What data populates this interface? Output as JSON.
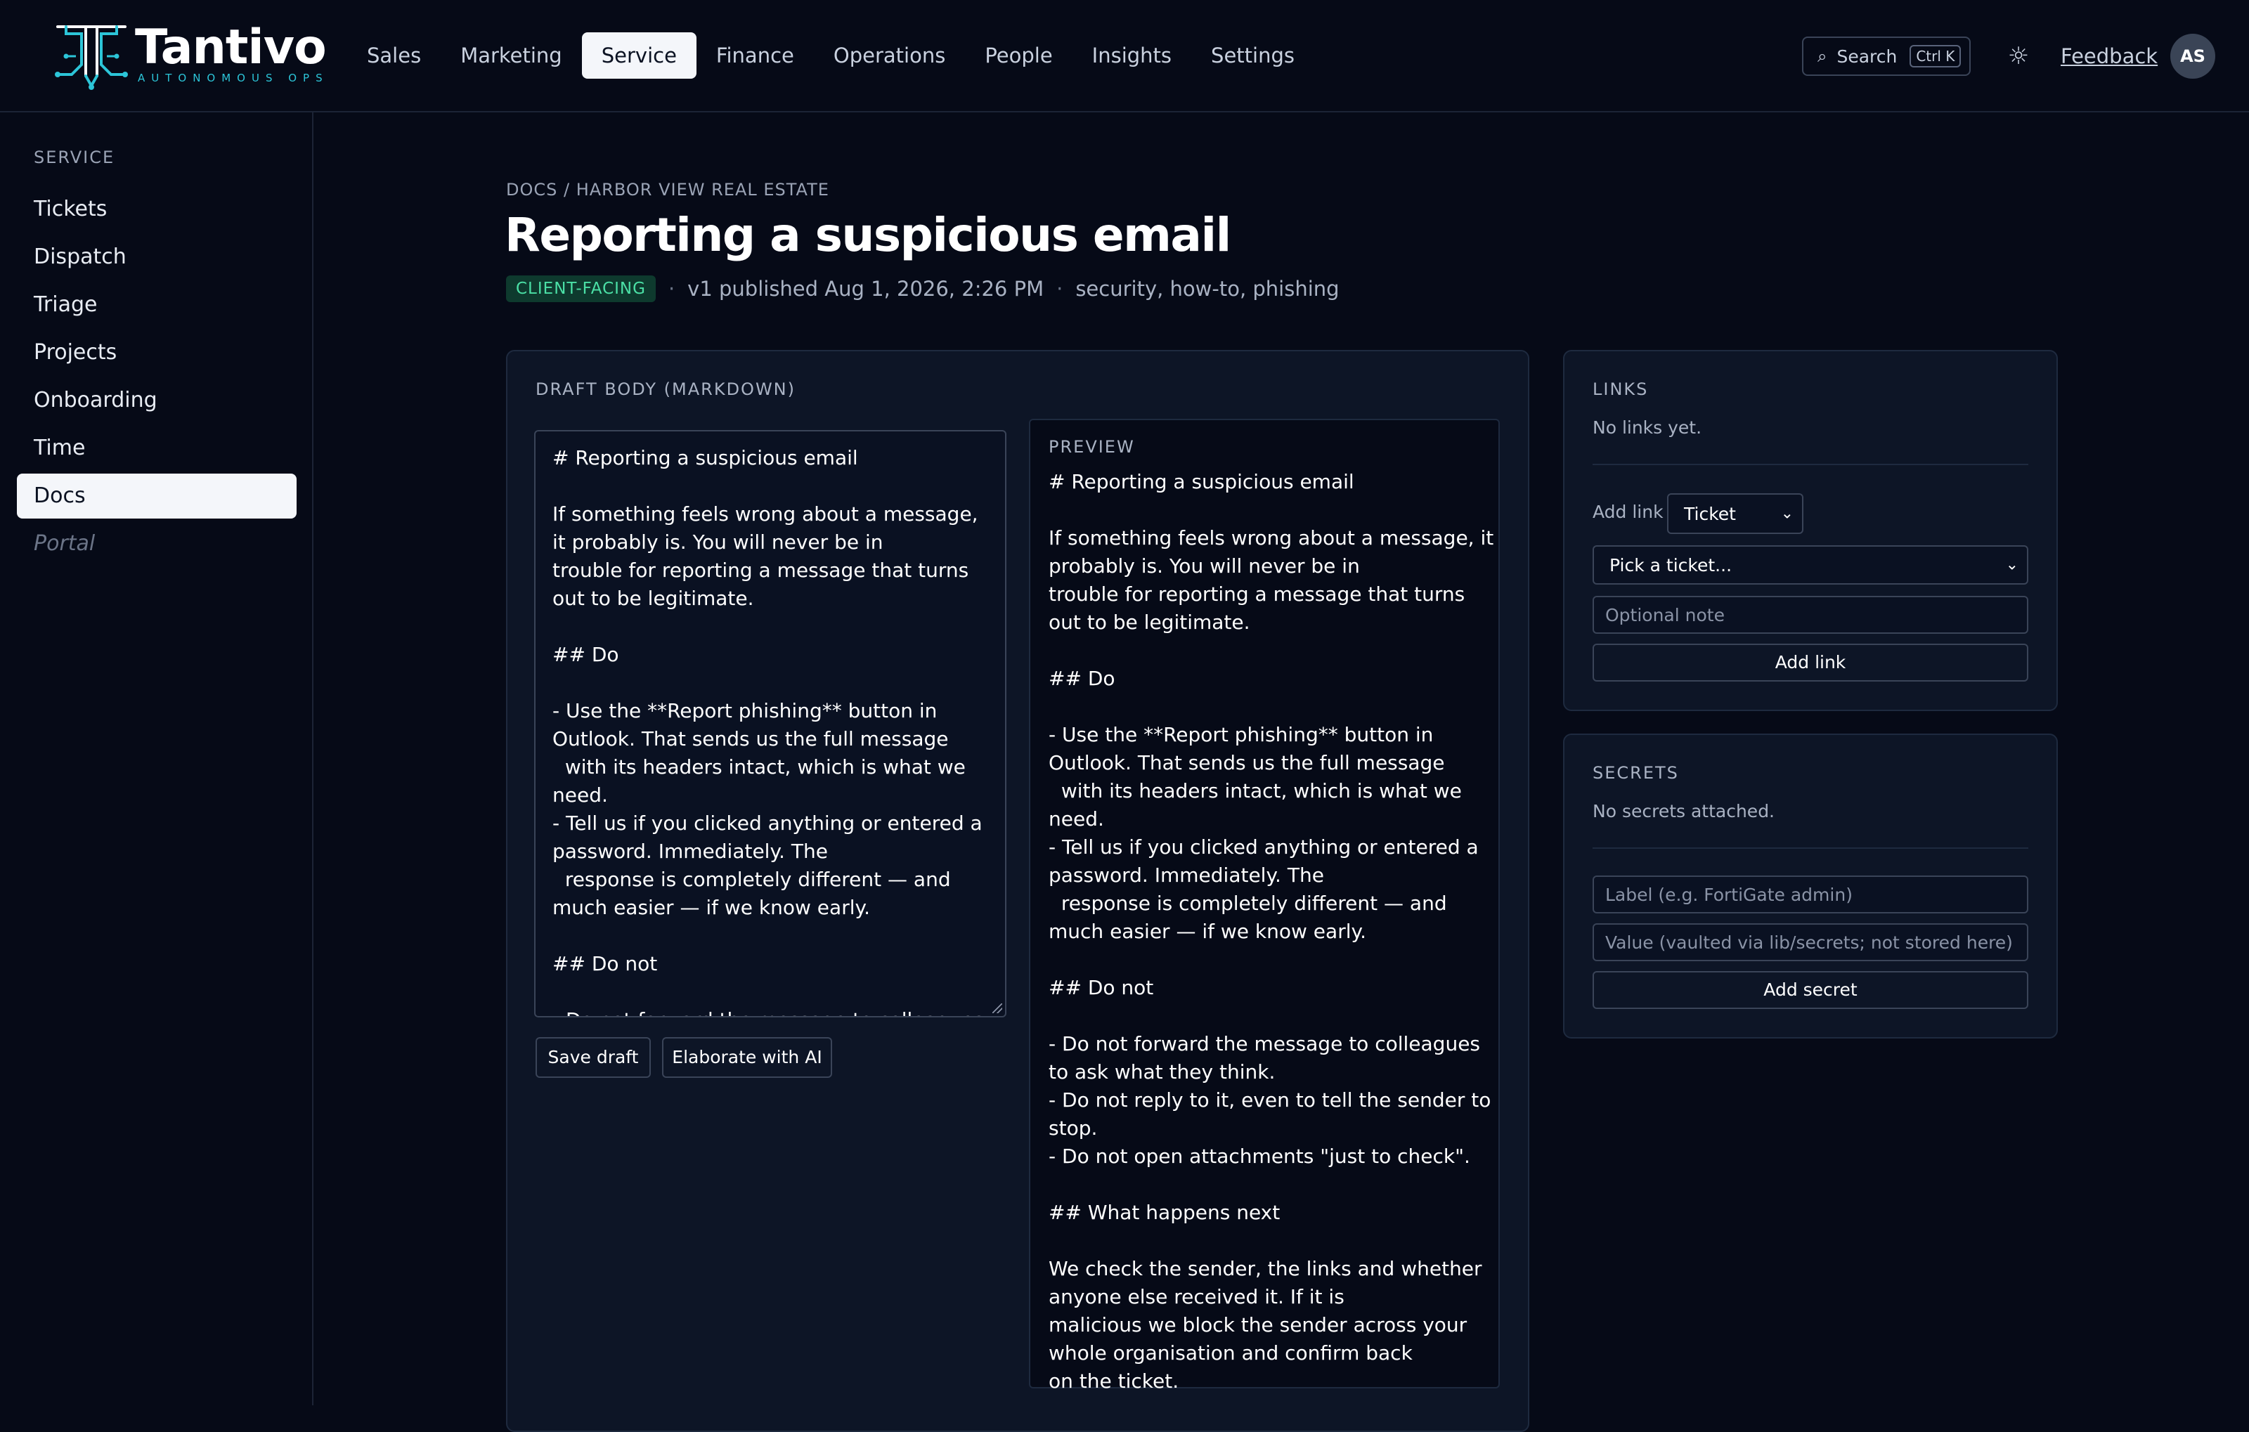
{
  "brand": {
    "name": "Tantivo",
    "tagline": "AUTONOMOUS OPS",
    "accent_color": "#2cc5d8"
  },
  "nav": {
    "items": [
      "Sales",
      "Marketing",
      "Service",
      "Finance",
      "Operations",
      "People",
      "Insights",
      "Settings"
    ],
    "active": "Service"
  },
  "header": {
    "search_label": "Search",
    "search_shortcut": "Ctrl K",
    "theme_icon": "sun-icon",
    "feedback_label": "Feedback",
    "avatar_initials": "AS"
  },
  "sidebar": {
    "heading": "SERVICE",
    "items": [
      "Tickets",
      "Dispatch",
      "Triage",
      "Projects",
      "Onboarding",
      "Time",
      "Docs",
      "Portal"
    ],
    "active": "Docs",
    "disabled": "Portal"
  },
  "page": {
    "breadcrumb": "DOCS / HARBOR VIEW REAL ESTATE",
    "title": "Reporting a suspicious email",
    "badge": "CLIENT-FACING",
    "version": "v1 published Aug 1, 2026, 2:26 PM",
    "tags": "security, how-to, phishing",
    "badge_color": "#4be0a6"
  },
  "editor": {
    "heading": "DRAFT BODY (MARKDOWN)",
    "body": "# Reporting a suspicious email\n\nIf something feels wrong about a message, it probably is. You will never be in\ntrouble for reporting a message that turns out to be legitimate.\n\n## Do\n\n- Use the **Report phishing** button in Outlook. That sends us the full message\n  with its headers intact, which is what we need.\n- Tell us if you clicked anything or entered a password. Immediately. The\n  response is completely different — and much easier — if we know early.\n\n## Do not\n\n- Do not forward the message to colleagues to ask what they think.",
    "save_label": "Save draft",
    "elaborate_label": "Elaborate with AI"
  },
  "preview": {
    "label": "PREVIEW",
    "body": "# Reporting a suspicious email\n\nIf something feels wrong about a message, it probably is. You will never be in\ntrouble for reporting a message that turns out to be legitimate.\n\n## Do\n\n- Use the **Report phishing** button in Outlook. That sends us the full message\n  with its headers intact, which is what we need.\n- Tell us if you clicked anything or entered a password. Immediately. The\n  response is completely different — and much easier — if we know early.\n\n## Do not\n\n- Do not forward the message to colleagues to ask what they think.\n- Do not reply to it, even to tell the sender to stop.\n- Do not open attachments \"just to check\".\n\n## What happens next\n\nWe check the sender, the links and whether anyone else received it. If it is\nmalicious we block the sender across your whole organisation and confirm back\non the ticket."
  },
  "links": {
    "heading": "LINKS",
    "empty": "No links yet.",
    "add_label": "Add link",
    "type_value": "Ticket",
    "ticket_placeholder": "Pick a ticket...",
    "note_placeholder": "Optional note",
    "add_button": "Add link"
  },
  "secrets": {
    "heading": "SECRETS",
    "empty": "No secrets attached.",
    "label_placeholder": "Label (e.g. FortiGate admin)",
    "value_placeholder": "Value (vaulted via lib/secrets; not stored here)",
    "add_button": "Add secret"
  }
}
